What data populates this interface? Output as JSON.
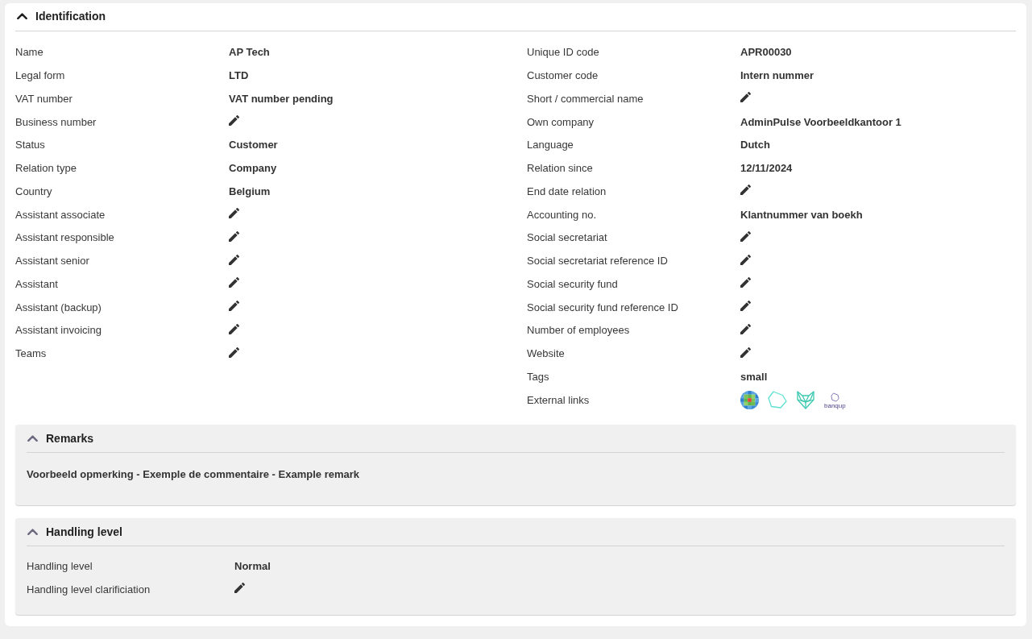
{
  "identification": {
    "title": "Identification",
    "expanded": true,
    "columns": [
      {
        "fields": [
          {
            "label": "Name",
            "kind": "text",
            "value": "AP Tech"
          },
          {
            "label": "Legal form",
            "kind": "text",
            "value": "LTD"
          },
          {
            "label": "VAT number",
            "kind": "text",
            "value": "VAT number pending"
          },
          {
            "label": "Business number",
            "kind": "edit"
          },
          {
            "label": "Status",
            "kind": "text",
            "value": "Customer"
          },
          {
            "label": "Relation type",
            "kind": "text",
            "value": "Company"
          },
          {
            "label": "Country",
            "kind": "text",
            "value": "Belgium"
          },
          {
            "label": "Assistant associate",
            "kind": "edit"
          },
          {
            "label": "Assistant responsible",
            "kind": "edit"
          },
          {
            "label": "Assistant senior",
            "kind": "edit"
          },
          {
            "label": "Assistant",
            "kind": "edit"
          },
          {
            "label": "Assistant (backup)",
            "kind": "edit"
          },
          {
            "label": "Assistant invoicing",
            "kind": "edit"
          },
          {
            "label": "Teams",
            "kind": "edit"
          }
        ]
      },
      {
        "fields": [
          {
            "label": "Unique ID code",
            "kind": "text",
            "value": "APR00030"
          },
          {
            "label": "Customer code",
            "kind": "text",
            "value": "Intern nummer"
          },
          {
            "label": "Short / commercial name",
            "kind": "edit"
          },
          {
            "label": "Own company",
            "kind": "text",
            "value": "AdminPulse Voorbeeldkantoor 1"
          },
          {
            "label": "Language",
            "kind": "text",
            "value": "Dutch"
          },
          {
            "label": "Relation since",
            "kind": "text",
            "value": "12/11/2024"
          },
          {
            "label": "End date relation",
            "kind": "edit"
          },
          {
            "label": "Accounting no.",
            "kind": "text",
            "value": "Klantnummer van boekh"
          },
          {
            "label": "Social secretariat",
            "kind": "edit"
          },
          {
            "label": "Social secretariat reference ID",
            "kind": "edit"
          },
          {
            "label": "Social security fund",
            "kind": "edit"
          },
          {
            "label": "Social security fund reference ID",
            "kind": "edit"
          },
          {
            "label": "Number of employees",
            "kind": "edit"
          },
          {
            "label": "Website",
            "kind": "edit"
          },
          {
            "label": "Tags",
            "kind": "text",
            "value": "small"
          },
          {
            "label": "External links",
            "kind": "links",
            "links": [
              {
                "kind": "mosaic"
              },
              {
                "kind": "polygon"
              },
              {
                "kind": "fox"
              },
              {
                "kind": "captioned",
                "caption": "banqup"
              }
            ]
          }
        ]
      }
    ]
  },
  "panels": [
    {
      "title": "Remarks",
      "expanded": true,
      "kind": "note",
      "text": "Voorbeeld opmerking - Exemple de commentaire - Example remark"
    },
    {
      "title": "Handling level",
      "expanded": true,
      "kind": "fields",
      "fields": [
        {
          "label": "Handling level",
          "kind": "text",
          "value": "Normal"
        },
        {
          "label": "Handling level clarificiation",
          "kind": "edit"
        }
      ]
    }
  ]
}
